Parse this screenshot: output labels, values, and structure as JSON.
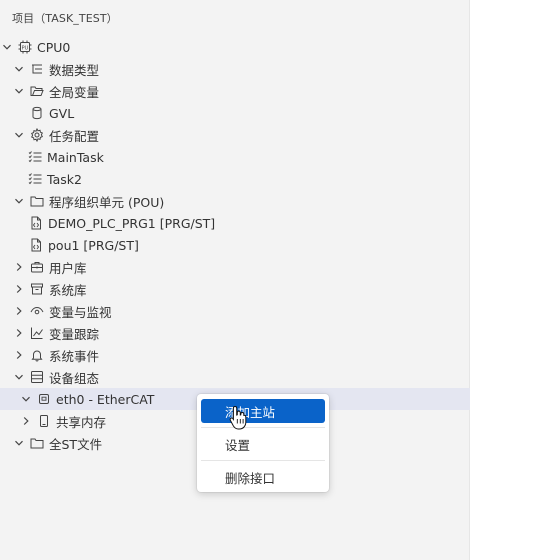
{
  "panel": {
    "header": "项目（TASK_TEST）"
  },
  "tree": {
    "cpu0": "CPU0",
    "data_types": "数据类型",
    "global_vars": "全局变量",
    "gvl": "GVL",
    "task_config": "任务配置",
    "main_task": "MainTask",
    "task2": "Task2",
    "pou": "程序组织单元 (POU)",
    "demo_prg": "DEMO_PLC_PRG1 [PRG/ST]",
    "pou1": "pou1 [PRG/ST]",
    "user_lib": "用户库",
    "system_lib": "系统库",
    "var_monitor": "变量与监视",
    "var_trace": "变量跟踪",
    "system_events": "系统事件",
    "device_config": "设备组态",
    "eth0": "eth0 - EtherCAT",
    "shared_mem": "共享内存",
    "all_st": "全ST文件"
  },
  "context_menu": {
    "add_master": "添加主站",
    "settings": "设置",
    "delete_interface": "删除接口"
  },
  "colors": {
    "selected_row": "#e4e6f1",
    "menu_active": "#0a63c9"
  }
}
